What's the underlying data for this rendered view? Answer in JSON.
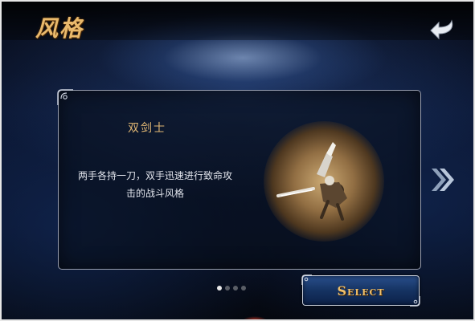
{
  "header": {
    "title": "风格",
    "back_icon": "back-arrow-icon"
  },
  "style_card": {
    "name": "双剑士",
    "description": "两手各持一刀，双手迅速进行致命攻击的战斗风格",
    "portrait_icon": "dual-sword-warrior-portrait"
  },
  "pager": {
    "total": 4,
    "active_index": 0
  },
  "actions": {
    "select_label": "Select",
    "next_icon": "double-chevron-right-icon"
  },
  "colors": {
    "title_gold": "#e9b96c",
    "button_blue": "#153362",
    "button_text": "#f0c06a"
  }
}
